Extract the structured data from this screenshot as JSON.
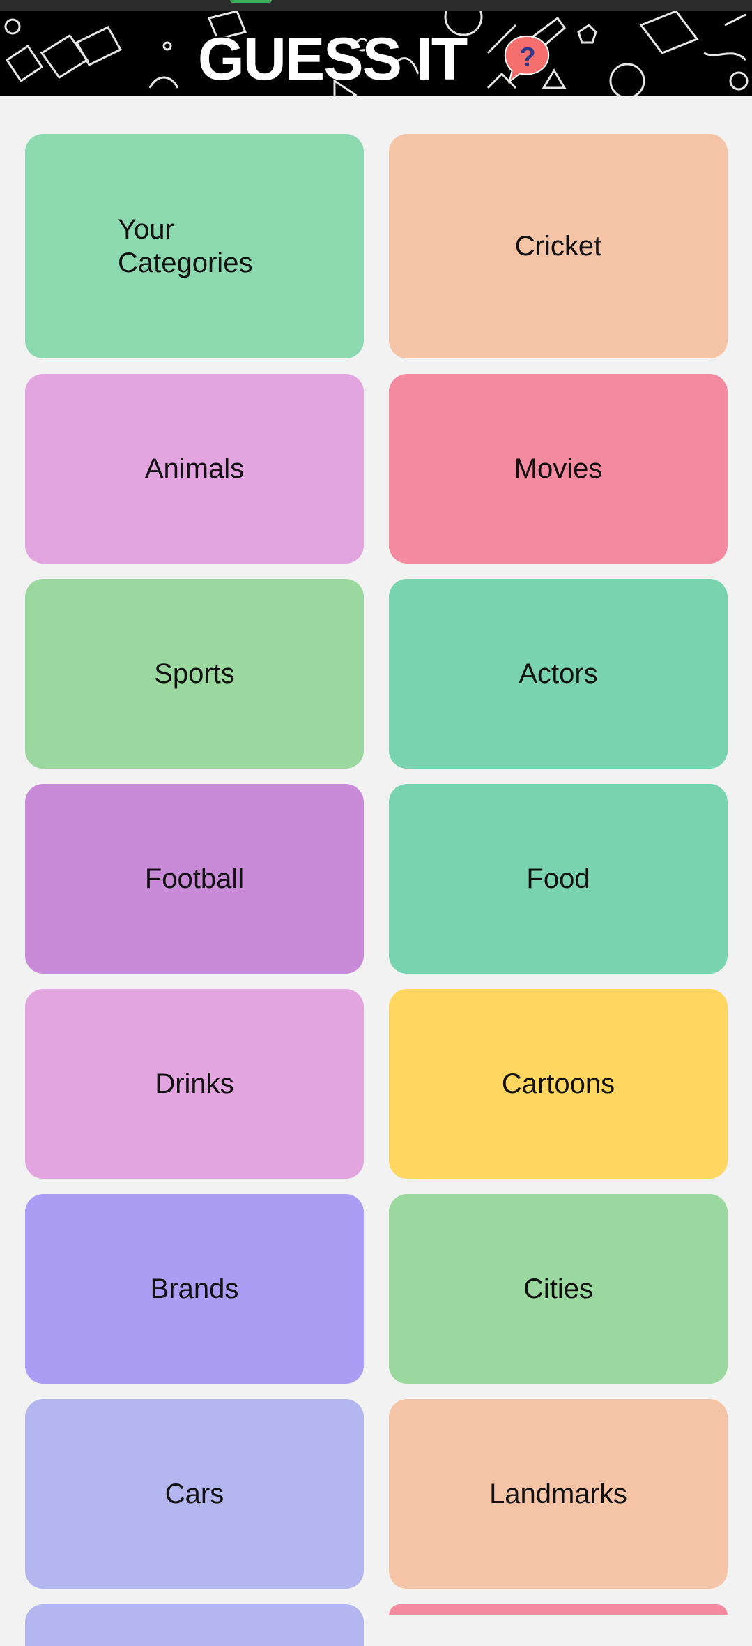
{
  "header": {
    "title": "GUESS IT",
    "icon": "question-bubble-icon",
    "background": "#000000",
    "icon_color": "#f46e6e"
  },
  "categories": [
    {
      "label": "Your Categories",
      "color": "#8dd9af"
    },
    {
      "label": "Cricket",
      "color": "#f5c4a6"
    },
    {
      "label": "Animals",
      "color": "#e2a5e0"
    },
    {
      "label": "Movies",
      "color": "#f48aa0"
    },
    {
      "label": "Sports",
      "color": "#9ad89f"
    },
    {
      "label": "Actors",
      "color": "#79d3af"
    },
    {
      "label": "Football",
      "color": "#c98ad8"
    },
    {
      "label": "Food",
      "color": "#79d3af"
    },
    {
      "label": "Drinks",
      "color": "#e2a5e0"
    },
    {
      "label": "Cartoons",
      "color": "#fed660"
    },
    {
      "label": "Brands",
      "color": "#ab9df3"
    },
    {
      "label": "Cities",
      "color": "#9ad89f"
    },
    {
      "label": "Cars",
      "color": "#b4b7ef"
    },
    {
      "label": "Landmarks",
      "color": "#f5c4a6"
    },
    {
      "label": "",
      "color": "#b4b7ef"
    },
    {
      "label": "",
      "color": "#f48aa0"
    }
  ],
  "colors": {
    "page_background": "#f2f2f2",
    "text": "#111111"
  }
}
